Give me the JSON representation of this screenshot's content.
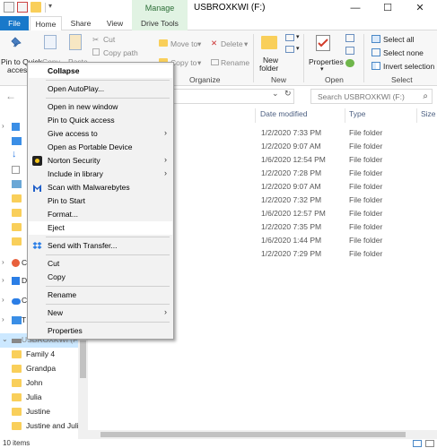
{
  "titlebar": {
    "manage_tab": "Manage",
    "title": "USBROXKWI (F:)",
    "minimize": "—",
    "maximize": "☐",
    "close": "✕"
  },
  "tabs": {
    "file": "File",
    "home": "Home",
    "share": "Share",
    "view": "View",
    "drive_tools": "Drive Tools"
  },
  "ribbon": {
    "pin_label_1": "Pin to Quick",
    "pin_label_2": "access",
    "copy": "Copy",
    "paste": "Paste",
    "cut": "Cut",
    "copy_path": "Copy path",
    "move_to": "Move to",
    "copy_to": "Copy to",
    "delete": "Delete",
    "rename": "Rename",
    "new_folder_1": "New",
    "new_folder_2": "folder",
    "properties": "Properties",
    "select_all": "Select all",
    "select_none": "Select none",
    "invert_selection": "Invert selection",
    "groups": {
      "organize": "Organize",
      "new": "New",
      "open": "Open",
      "select": "Select"
    }
  },
  "address": {
    "search_placeholder": "Search USBROXKWI (F:)",
    "dropdown": "⌄",
    "refresh": "↻"
  },
  "nav": {
    "items": [
      {
        "label": "Family 4"
      },
      {
        "label": "Grandpa"
      },
      {
        "label": "John"
      },
      {
        "label": "Julia"
      },
      {
        "label": "Justine"
      },
      {
        "label": "Justine and Julia"
      }
    ],
    "partial_labels": [
      "C",
      "D",
      "C",
      "T"
    ],
    "drive_label": "USBROXKWI (F:)"
  },
  "columns": {
    "date_modified": "Date modified",
    "type": "Type",
    "size": "Size"
  },
  "rows": [
    {
      "date": "1/2/2020 7:33 PM",
      "type": "File folder"
    },
    {
      "date": "1/2/2020 9:07 AM",
      "type": "File folder"
    },
    {
      "date": "1/6/2020 12:54 PM",
      "type": "File folder"
    },
    {
      "date": "1/2/2020 7:28 PM",
      "type": "File folder"
    },
    {
      "date": "1/2/2020 9:07 AM",
      "type": "File folder"
    },
    {
      "date": "1/2/2020 7:32 PM",
      "type": "File folder"
    },
    {
      "date": "1/6/2020 12:57 PM",
      "type": "File folder"
    },
    {
      "date": "1/2/2020 7:35 PM",
      "type": "File folder"
    },
    {
      "date": "1/6/2020 1:44 PM",
      "type": "File folder"
    },
    {
      "date": "1/2/2020 7:29 PM",
      "type": "File folder"
    }
  ],
  "status": {
    "items_count": "10 items"
  },
  "context_menu": {
    "collapse": "Collapse",
    "open_autoplay": "Open AutoPlay...",
    "open_new_window": "Open in new window",
    "pin_quick_access": "Pin to Quick access",
    "give_access": "Give access to",
    "open_portable": "Open as Portable Device",
    "norton": "Norton Security",
    "include_library": "Include in library",
    "scan_malwarebytes": "Scan with Malwarebytes",
    "pin_start": "Pin to Start",
    "format": "Format...",
    "eject": "Eject",
    "send_transfer": "Send with Transfer...",
    "cut": "Cut",
    "copy": "Copy",
    "rename": "Rename",
    "new": "New",
    "properties": "Properties",
    "submenu_arrow": "›"
  },
  "colors": {
    "file_tab": "#1979ca",
    "manage_tab_bg": "#e1f3e3",
    "folder": "#f9cf5a",
    "selection": "#cce8ff",
    "menu_bg": "#f2f2f2"
  }
}
